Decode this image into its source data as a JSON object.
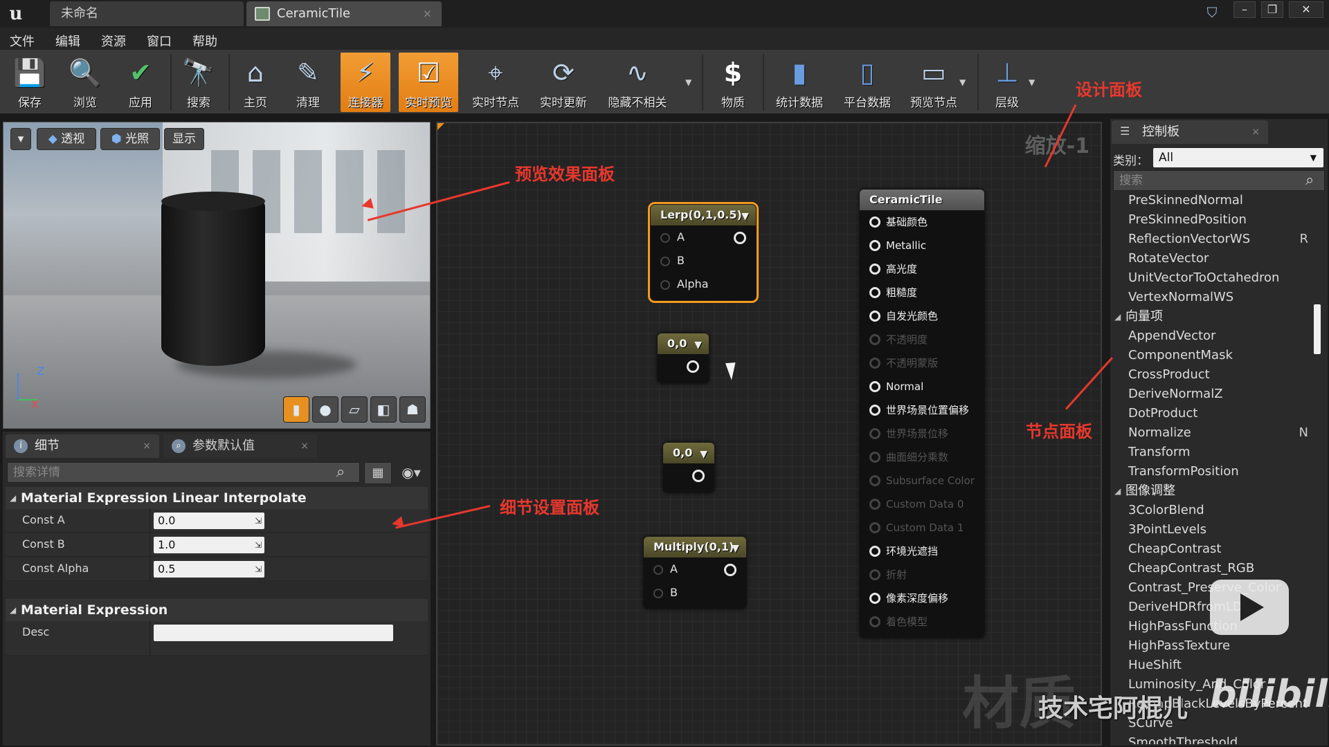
{
  "window": {
    "logo": "u",
    "tabs": [
      {
        "label": "未命名"
      },
      {
        "label": "CeramicTile"
      }
    ],
    "close_glyph": "×",
    "controls": [
      "–",
      "❐",
      "✕"
    ]
  },
  "menu": [
    "文件",
    "编辑",
    "资源",
    "窗口",
    "帮助"
  ],
  "toolbar": {
    "buttons": [
      {
        "label": "保存",
        "icon": "save-icon",
        "glyph": "💾"
      },
      {
        "label": "浏览",
        "icon": "browse-icon",
        "glyph": "🔍"
      },
      {
        "label": "应用",
        "icon": "apply-icon",
        "glyph": "✔"
      },
      {
        "label": "搜索",
        "icon": "search-icon",
        "glyph": "🔭"
      },
      {
        "label": "主页",
        "icon": "home-icon",
        "glyph": "⌂"
      },
      {
        "label": "清理",
        "icon": "clean-icon",
        "glyph": "✎"
      },
      {
        "label": "连接器",
        "icon": "connector-icon",
        "glyph": "⚡",
        "active": true
      },
      {
        "label": "实时预览",
        "icon": "live-preview-icon",
        "glyph": "☑",
        "active": true
      },
      {
        "label": "实时节点",
        "icon": "live-nodes-icon",
        "glyph": "⌖"
      },
      {
        "label": "实时更新",
        "icon": "live-update-icon",
        "glyph": "⟳"
      },
      {
        "label": "隐藏不相关",
        "icon": "hide-unrelated-icon",
        "glyph": "∿"
      },
      {
        "label": "物质",
        "icon": "material-stats-icon",
        "glyph": "$"
      },
      {
        "label": "统计数据",
        "icon": "stats-icon",
        "glyph": "▮"
      },
      {
        "label": "平台数据",
        "icon": "platform-stats-icon",
        "glyph": "▯"
      },
      {
        "label": "预览节点",
        "icon": "preview-node-icon",
        "glyph": "▭"
      },
      {
        "label": "层级",
        "icon": "hierarchy-icon",
        "glyph": "⊥"
      }
    ]
  },
  "viewport": {
    "chips": [
      "透视",
      "光照",
      "显示"
    ],
    "axes": {
      "z": "Z",
      "x": "X"
    }
  },
  "details": {
    "tabs": [
      {
        "label": "细节"
      },
      {
        "label": "参数默认值"
      }
    ],
    "search_placeholder": "搜索详情",
    "sections": [
      {
        "title": "Material Expression Linear Interpolate",
        "rows": [
          {
            "label": "Const A",
            "value": "0.0"
          },
          {
            "label": "Const B",
            "value": "1.0"
          },
          {
            "label": "Const Alpha",
            "value": "0.5"
          }
        ]
      },
      {
        "title": "Material Expression",
        "rows": [
          {
            "label": "Desc",
            "value": ""
          }
        ]
      }
    ]
  },
  "graph": {
    "zoom": "缩放-1",
    "nodes": {
      "lerp": {
        "title": "Lerp(0,1,0.5)",
        "pins": [
          "A",
          "B",
          "Alpha"
        ]
      },
      "const1": {
        "title": "0,0"
      },
      "const2": {
        "title": "0,0"
      },
      "multiply": {
        "title": "Multiply(0,1)",
        "pins": [
          "A",
          "B"
        ]
      }
    },
    "result": {
      "title": "CeramicTile",
      "pins": [
        {
          "label": "基础颜色",
          "enabled": true
        },
        {
          "label": "Metallic",
          "enabled": true
        },
        {
          "label": "高光度",
          "enabled": true
        },
        {
          "label": "粗糙度",
          "enabled": true
        },
        {
          "label": "自发光颜色",
          "enabled": true
        },
        {
          "label": "不透明度",
          "enabled": false
        },
        {
          "label": "不透明蒙版",
          "enabled": false
        },
        {
          "label": "Normal",
          "enabled": true
        },
        {
          "label": "世界场景位置偏移",
          "enabled": true
        },
        {
          "label": "世界场景位移",
          "enabled": false
        },
        {
          "label": "曲面细分乘数",
          "enabled": false
        },
        {
          "label": "Subsurface Color",
          "enabled": false
        },
        {
          "label": "Custom Data 0",
          "enabled": false
        },
        {
          "label": "Custom Data 1",
          "enabled": false
        },
        {
          "label": "环境光遮挡",
          "enabled": true
        },
        {
          "label": "折射",
          "enabled": false
        },
        {
          "label": "像素深度偏移",
          "enabled": true
        },
        {
          "label": "着色模型",
          "enabled": false
        }
      ]
    }
  },
  "palette": {
    "tab": "控制板",
    "category_label": "类别：",
    "category_value": "All",
    "search_placeholder": "搜索",
    "items": [
      {
        "type": "item",
        "label": "PreSkinnedNormal"
      },
      {
        "type": "item",
        "label": "PreSkinnedPosition"
      },
      {
        "type": "item",
        "label": "ReflectionVectorWS",
        "key": "R"
      },
      {
        "type": "item",
        "label": "RotateVector"
      },
      {
        "type": "item",
        "label": "UnitVectorToOctahedron"
      },
      {
        "type": "item",
        "label": "VertexNormalWS"
      },
      {
        "type": "category",
        "label": "向量项"
      },
      {
        "type": "item",
        "label": "AppendVector"
      },
      {
        "type": "item",
        "label": "ComponentMask"
      },
      {
        "type": "item",
        "label": "CrossProduct"
      },
      {
        "type": "item",
        "label": "DeriveNormalZ"
      },
      {
        "type": "item",
        "label": "DotProduct"
      },
      {
        "type": "item",
        "label": "Normalize",
        "key": "N"
      },
      {
        "type": "item",
        "label": "Transform"
      },
      {
        "type": "item",
        "label": "TransformPosition"
      },
      {
        "type": "category",
        "label": "图像调整"
      },
      {
        "type": "item",
        "label": "3ColorBlend"
      },
      {
        "type": "item",
        "label": "3PointLevels"
      },
      {
        "type": "item",
        "label": "CheapContrast"
      },
      {
        "type": "item",
        "label": "CheapContrast_RGB"
      },
      {
        "type": "item",
        "label": "Contrast_Preserve_Color"
      },
      {
        "type": "item",
        "label": "DeriveHDRfromLDR"
      },
      {
        "type": "item",
        "label": "HighPassFunction"
      },
      {
        "type": "item",
        "label": "HighPassTexture"
      },
      {
        "type": "item",
        "label": "HueShift"
      },
      {
        "type": "item",
        "label": "Luminosity_And_Color"
      },
      {
        "type": "item",
        "label": "RemapBlackLevelsByPercent"
      },
      {
        "type": "item",
        "label": "SCurve"
      },
      {
        "type": "item",
        "label": "SmoothThreshold"
      }
    ]
  },
  "annotations": {
    "design": "设计面板",
    "preview": "预览效果面板",
    "details": "细节设置面板",
    "nodes": "节点面板"
  },
  "watermarks": {
    "material": "材质",
    "author": "技术宅阿棍儿",
    "brand": "bilibili"
  },
  "colors": {
    "accent": "#f39a1e",
    "annotation": "#e8382d"
  }
}
